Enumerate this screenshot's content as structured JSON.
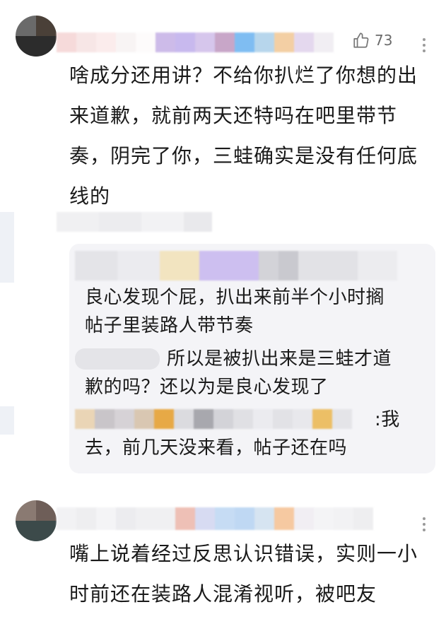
{
  "comments": [
    {
      "likes": "73",
      "body": "啥成分还用讲？不给你扒烂了你想的出来道歉，就前两天还特吗在吧里带节奏，阴完了你，三蛙确实是没有任何底线的"
    },
    {
      "body": "嘴上说着经过反思认识错误，实则一小时前还在装路人混淆视听，被吧友"
    }
  ],
  "replies": [
    {
      "text_line1": "良心发现个屁，扒出来前半个小时搁",
      "text_line2": "帖子里装路人带节奏"
    },
    {
      "text_line1": "所以是被扒出来是三蛙才道",
      "text_line2": "歉的吗？还以为是良心发现了"
    },
    {
      "text_line1": ":我",
      "text_line2": "去，前几天没来看，帖子还在吗"
    }
  ],
  "icons": [
    "thumbs-up-icon",
    "more-vertical-icon"
  ],
  "colors": {
    "text": "#1a1a1a",
    "secondary": "#6b6b6b",
    "reply_bg": "#f4f4f7"
  }
}
